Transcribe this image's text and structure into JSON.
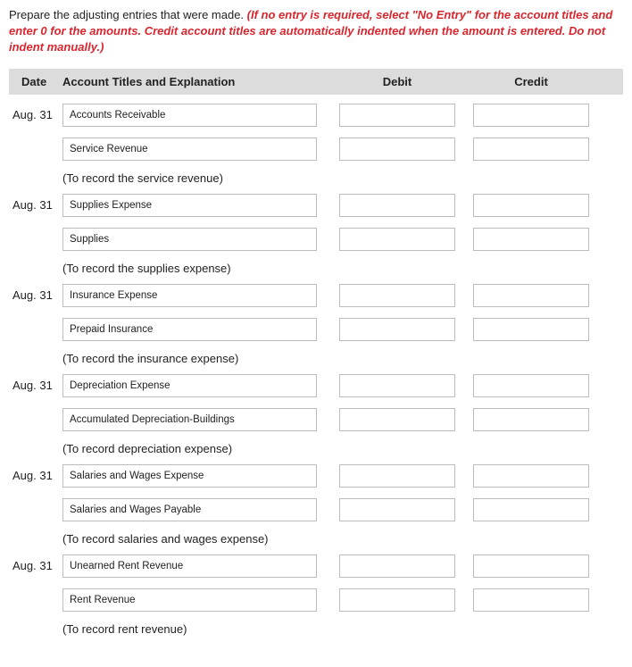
{
  "intro": {
    "black": "Prepare the adjusting entries that were made. ",
    "red": "(If no entry is required, select \"No Entry\" for the account titles and enter 0 for the amounts. Credit account titles are automatically indented when the amount is entered. Do not indent manually.)"
  },
  "headers": {
    "date": "Date",
    "acct": "Account Titles and Explanation",
    "debit": "Debit",
    "credit": "Credit"
  },
  "entries": [
    {
      "date": "Aug. 31",
      "debit_acct": "Accounts Receivable",
      "credit_acct": "Service Revenue",
      "explain": "(To record the service revenue)"
    },
    {
      "date": "Aug. 31",
      "debit_acct": "Supplies Expense",
      "credit_acct": "Supplies",
      "explain": "(To record the supplies expense)"
    },
    {
      "date": "Aug. 31",
      "debit_acct": "Insurance Expense",
      "credit_acct": "Prepaid Insurance",
      "explain": "(To record the insurance expense)"
    },
    {
      "date": "Aug. 31",
      "debit_acct": "Depreciation Expense",
      "credit_acct": "Accumulated Depreciation-Buildings",
      "explain": "(To record depreciation expense)"
    },
    {
      "date": "Aug. 31",
      "debit_acct": "Salaries and Wages Expense",
      "credit_acct": "Salaries and Wages Payable",
      "explain": "(To record salaries and wages expense)"
    },
    {
      "date": "Aug. 31",
      "debit_acct": "Unearned Rent Revenue",
      "credit_acct": "Rent Revenue",
      "explain": "(To record rent revenue)"
    }
  ]
}
